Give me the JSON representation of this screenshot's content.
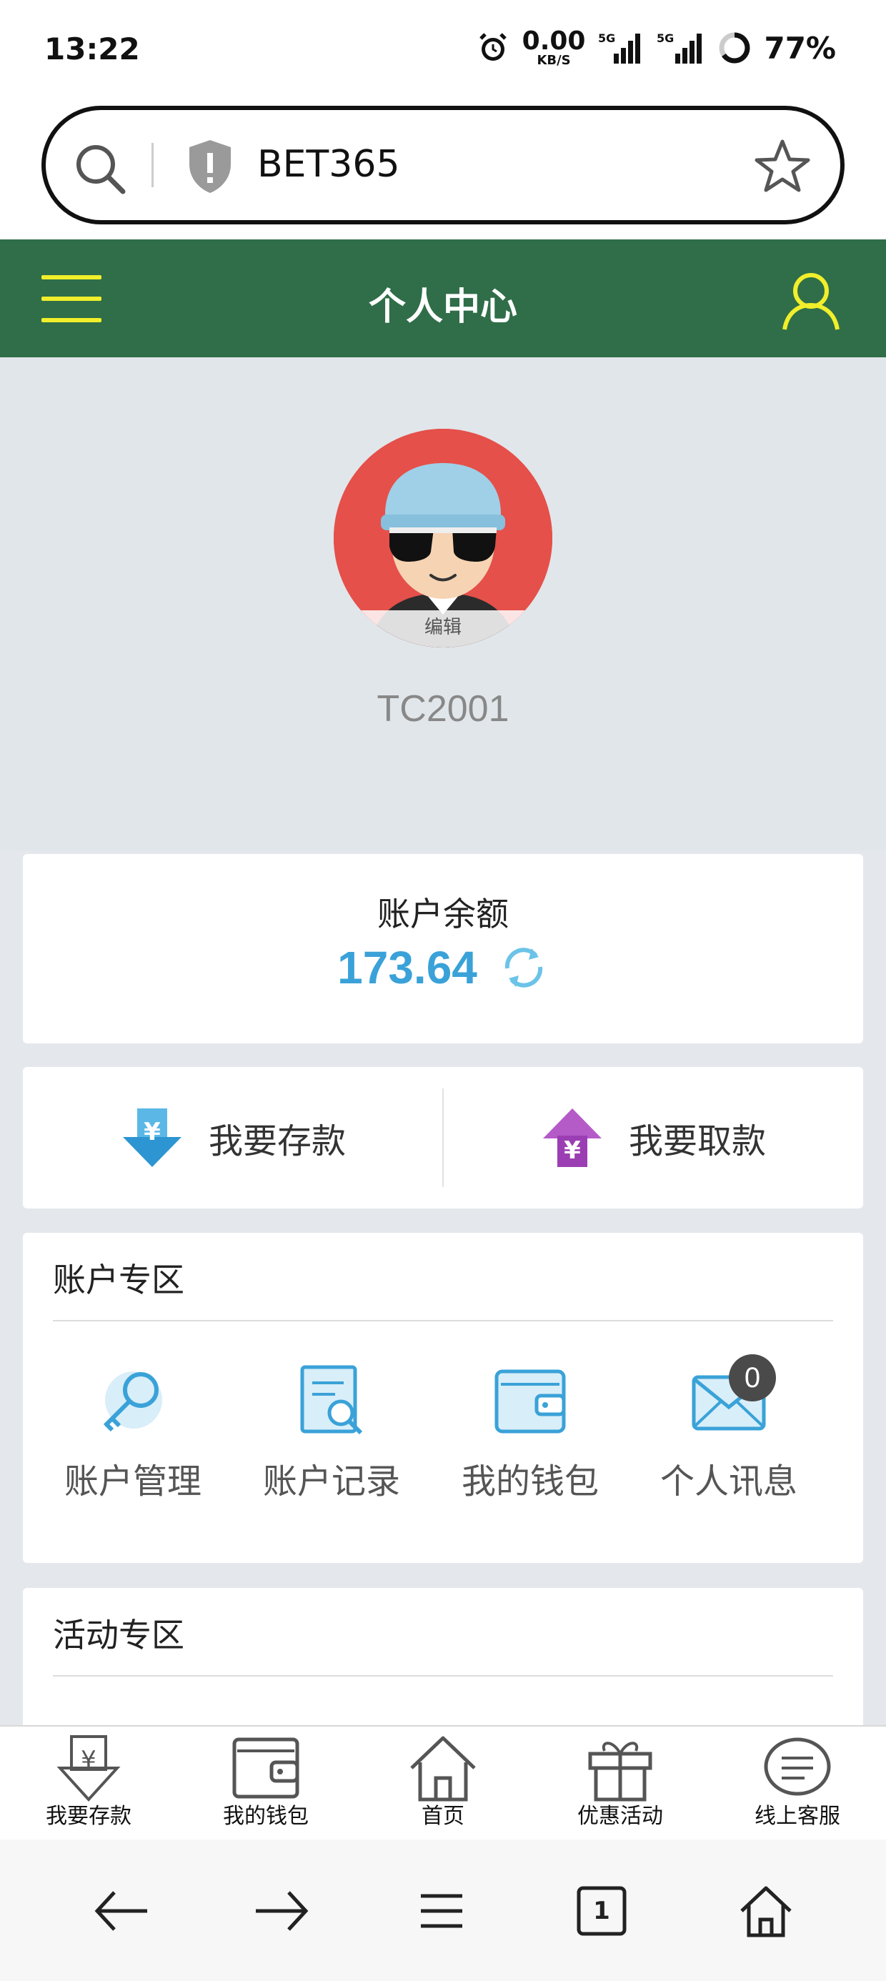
{
  "status_bar": {
    "time": "13:22",
    "net_speed": "0.00",
    "net_unit": "KB/S",
    "battery": "77%"
  },
  "url_bar": {
    "text": "BET365"
  },
  "header": {
    "title": "个人中心"
  },
  "profile": {
    "edit_label": "编辑",
    "username": "TC2001"
  },
  "balance": {
    "label": "账户余额",
    "value": "173.64"
  },
  "actions": {
    "deposit": "我要存款",
    "withdraw": "我要取款"
  },
  "account_section": {
    "title": "账户专区",
    "items": [
      {
        "label": "账户管理",
        "icon": "key-icon"
      },
      {
        "label": "账户记录",
        "icon": "record-search-icon"
      },
      {
        "label": "我的钱包",
        "icon": "wallet-icon"
      },
      {
        "label": "个人讯息",
        "icon": "envelope-icon",
        "badge": "0"
      }
    ]
  },
  "promo_section": {
    "title": "活动专区"
  },
  "tabbar": [
    {
      "label": "我要存款",
      "icon": "deposit-icon"
    },
    {
      "label": "我的钱包",
      "icon": "wallet-icon"
    },
    {
      "label": "首页",
      "icon": "home-icon"
    },
    {
      "label": "优惠活动",
      "icon": "gift-icon"
    },
    {
      "label": "线上客服",
      "icon": "chat-icon"
    }
  ],
  "browser_nav": {
    "tab_count": "1"
  },
  "colors": {
    "header_green": "#2f6e48",
    "accent_yellow": "#f1ee2b",
    "balance_blue": "#3aa2d8"
  }
}
